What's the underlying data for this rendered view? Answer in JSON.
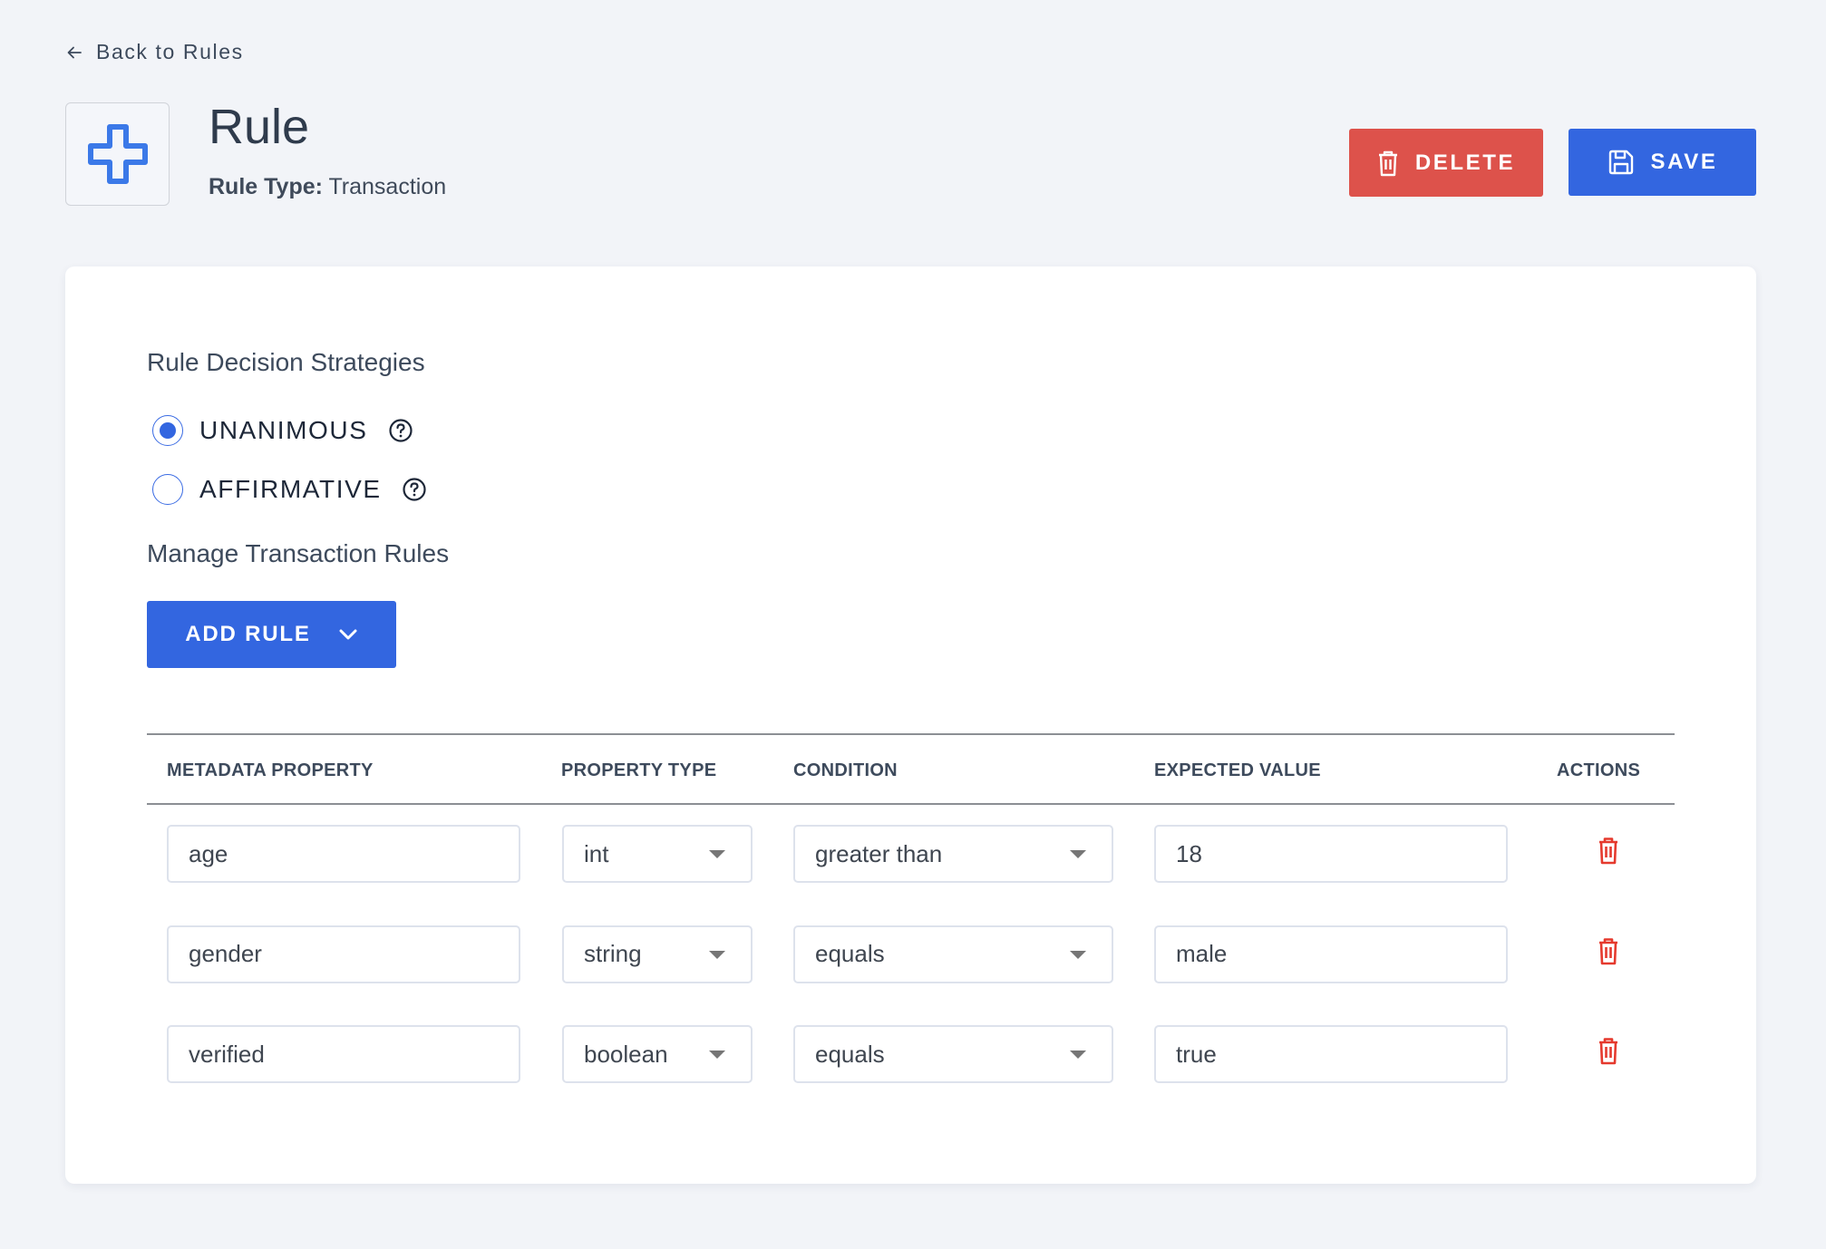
{
  "nav": {
    "back_label": "Back to Rules"
  },
  "header": {
    "title": "Rule",
    "rule_type_label": "Rule Type:",
    "rule_type_value": "Transaction",
    "icon": "plus-outline-icon"
  },
  "toolbar": {
    "delete_label": "DELETE",
    "save_label": "SAVE"
  },
  "colors": {
    "primary": "#3366e0",
    "danger": "#dd524b",
    "trash_icon": "#e53a2e",
    "background": "#f2f4f8"
  },
  "strategies": {
    "heading": "Rule Decision Strategies",
    "options": [
      {
        "label": "UNANIMOUS",
        "selected": true
      },
      {
        "label": "AFFIRMATIVE",
        "selected": false
      }
    ]
  },
  "rules": {
    "heading": "Manage Transaction Rules",
    "add_label": "ADD RULE",
    "columns": [
      "METADATA PROPERTY",
      "PROPERTY TYPE",
      "CONDITION",
      "EXPECTED VALUE",
      "ACTIONS"
    ],
    "rows": [
      {
        "property": "age",
        "type": "int",
        "condition": "greater than",
        "value": "18"
      },
      {
        "property": "gender",
        "type": "string",
        "condition": "equals",
        "value": "male"
      },
      {
        "property": "verified",
        "type": "boolean",
        "condition": "equals",
        "value": "true"
      }
    ]
  }
}
